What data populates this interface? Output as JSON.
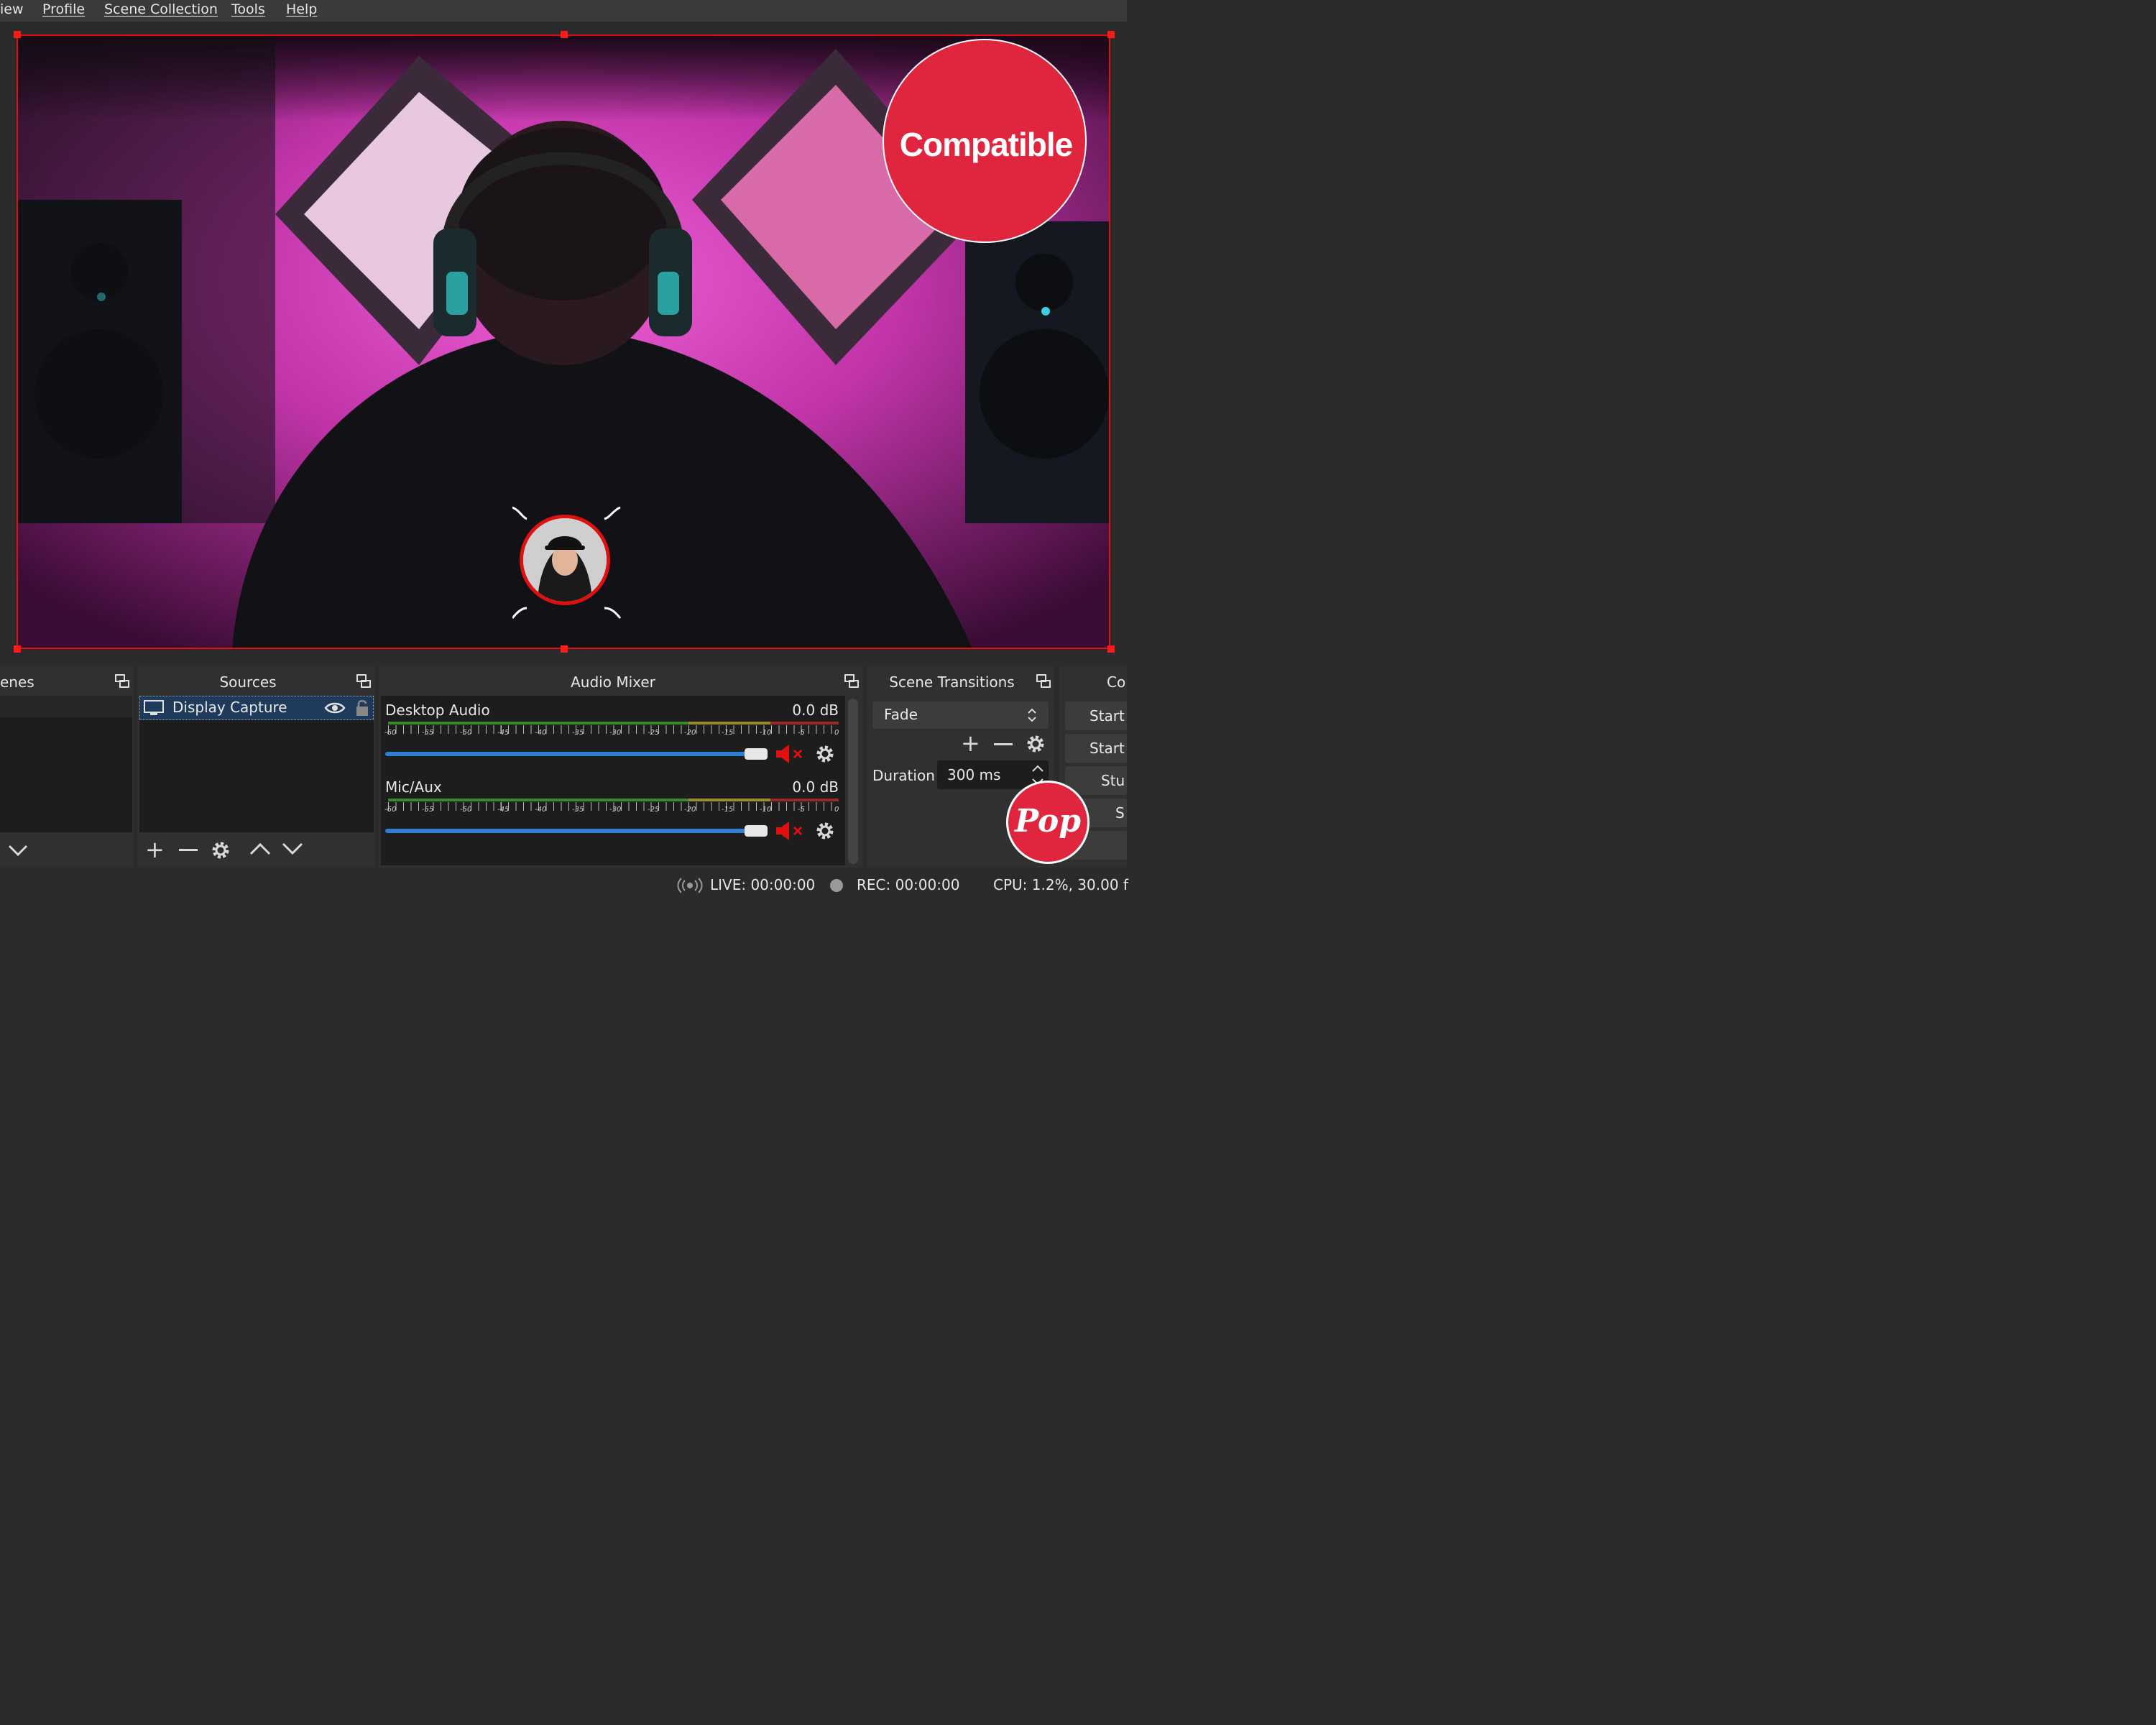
{
  "menubar": {
    "items": [
      "iew",
      "Profile",
      "Scene Collection",
      "Tools",
      "Help"
    ]
  },
  "preview": {
    "overlay_badge": "Compatible",
    "pop_badge": "Pop"
  },
  "scenes": {
    "title": "enes"
  },
  "sources": {
    "title": "Sources",
    "items": [
      {
        "label": "Display Capture",
        "visible": true,
        "locked": false
      }
    ]
  },
  "audio_mixer": {
    "title": "Audio Mixer",
    "scale_labels": [
      "-60",
      "-55",
      "-50",
      "-45",
      "-40",
      "-35",
      "-30",
      "-25",
      "-20",
      "-15",
      "-10",
      "-5",
      "0"
    ],
    "channels": [
      {
        "name": "Desktop Audio",
        "level": "0.0 dB",
        "fader": 1.0,
        "muted": true
      },
      {
        "name": "Mic/Aux",
        "level": "0.0 dB",
        "fader": 1.0,
        "muted": true
      }
    ]
  },
  "scene_transitions": {
    "title": "Scene Transitions",
    "selected": "Fade",
    "duration_label": "Duration",
    "duration_value": "300 ms"
  },
  "controls": {
    "title": "Co",
    "buttons": [
      "Start",
      "Start",
      "Stu",
      "S"
    ]
  },
  "statusbar": {
    "live": "LIVE: 00:00:00",
    "rec": "REC: 00:00:00",
    "cpu": "CPU: 1.2%, 30.00 f"
  },
  "colors": {
    "accent_red": "#e0263f",
    "selection_red": "#e01010",
    "fader_blue": "#2d7fd3",
    "meter_green": "#3a8a2a",
    "meter_yellow": "#9a8a2a",
    "meter_red": "#9a2a2a"
  }
}
